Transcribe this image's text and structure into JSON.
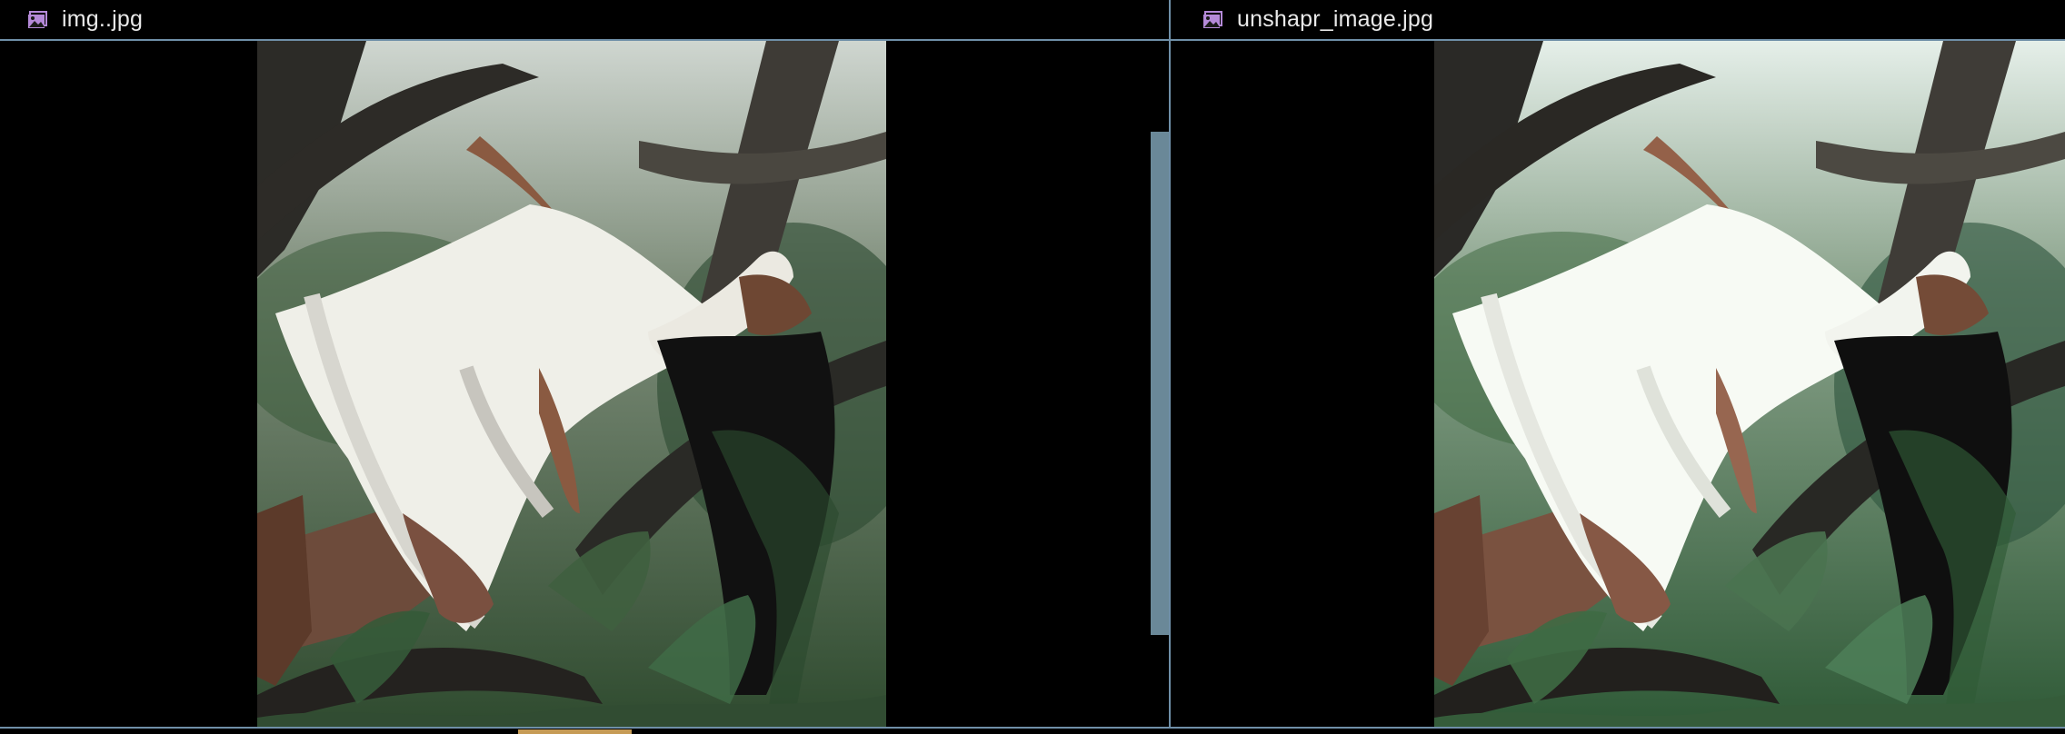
{
  "left_pane": {
    "filename": "img..jpg",
    "icon": "image-icon"
  },
  "right_pane": {
    "filename": "unshapr_image.jpg",
    "icon": "image-icon"
  },
  "colors": {
    "background": "#000000",
    "divider": "#6f8fa8",
    "tab_text": "#e9e9e9",
    "icon": "#b58ad9",
    "scrollbar": "#6a8898",
    "bottom_accent": "#c69b56"
  }
}
